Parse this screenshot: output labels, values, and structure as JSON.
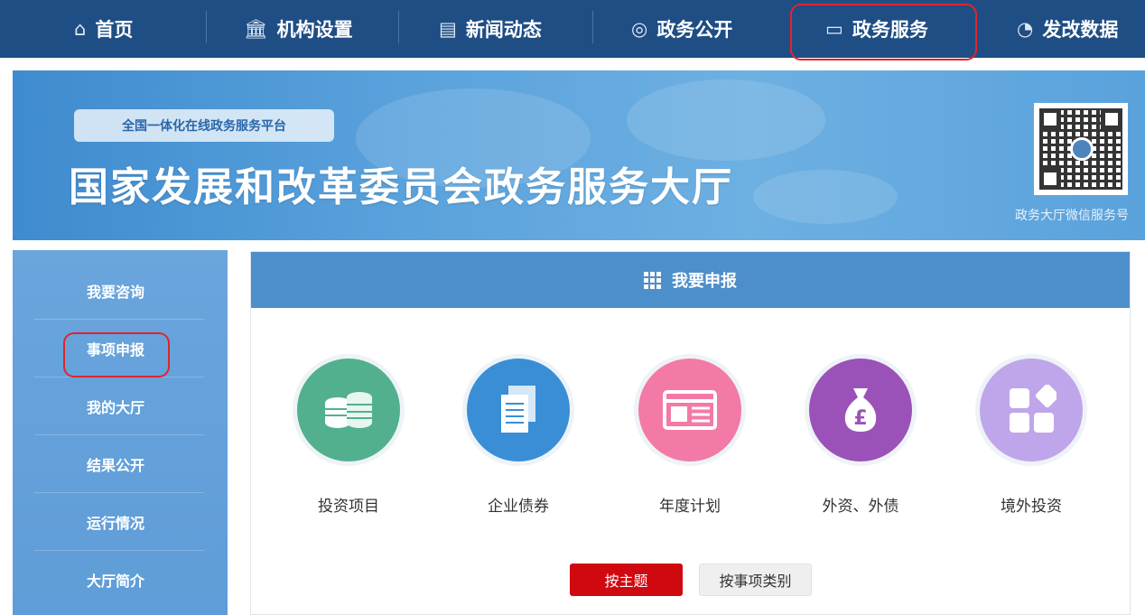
{
  "nav": {
    "items": [
      {
        "label": "首页",
        "icon": "home-icon",
        "glyph": "⌂"
      },
      {
        "label": "机构设置",
        "icon": "building-icon",
        "glyph": "🏛"
      },
      {
        "label": "新闻动态",
        "icon": "newspaper-icon",
        "glyph": "▤"
      },
      {
        "label": "政务公开",
        "icon": "broadcast-icon",
        "glyph": "◎"
      },
      {
        "label": "政务服务",
        "icon": "document-icon",
        "glyph": "▭"
      },
      {
        "label": "发改数据",
        "icon": "pie-chart-icon",
        "glyph": "◔"
      }
    ],
    "active_index": 4
  },
  "banner": {
    "tag": "全国一体化在线政务服务平台",
    "title": "国家发展和改革委员会政务服务大厅",
    "qr_caption": "政务大厅微信服务号"
  },
  "sidebar": {
    "items": [
      "我要咨询",
      "事项申报",
      "我的大厅",
      "结果公开",
      "运行情况",
      "大厅简介"
    ],
    "highlighted_index": 1
  },
  "panel": {
    "title": "我要申报",
    "services": [
      {
        "label": "投资项目",
        "icon": "coins-icon",
        "color": "#52b08e"
      },
      {
        "label": "企业债券",
        "icon": "documents-icon",
        "color": "#3a8ed6"
      },
      {
        "label": "年度计划",
        "icon": "newspaper-icon",
        "color": "#f37aa6"
      },
      {
        "label": "外资、外债",
        "icon": "money-bag-icon",
        "color": "#9b52b8"
      },
      {
        "label": "境外投资",
        "icon": "apps-icon",
        "color": "#bfa6ea"
      }
    ],
    "buttons": {
      "by_theme": "按主题",
      "by_category": "按事项类别"
    }
  },
  "colors": {
    "nav_bg": "#1f4e85",
    "highlight_border": "#e0242c",
    "active_button": "#d0080f",
    "panel_header": "#4d8fcb"
  }
}
